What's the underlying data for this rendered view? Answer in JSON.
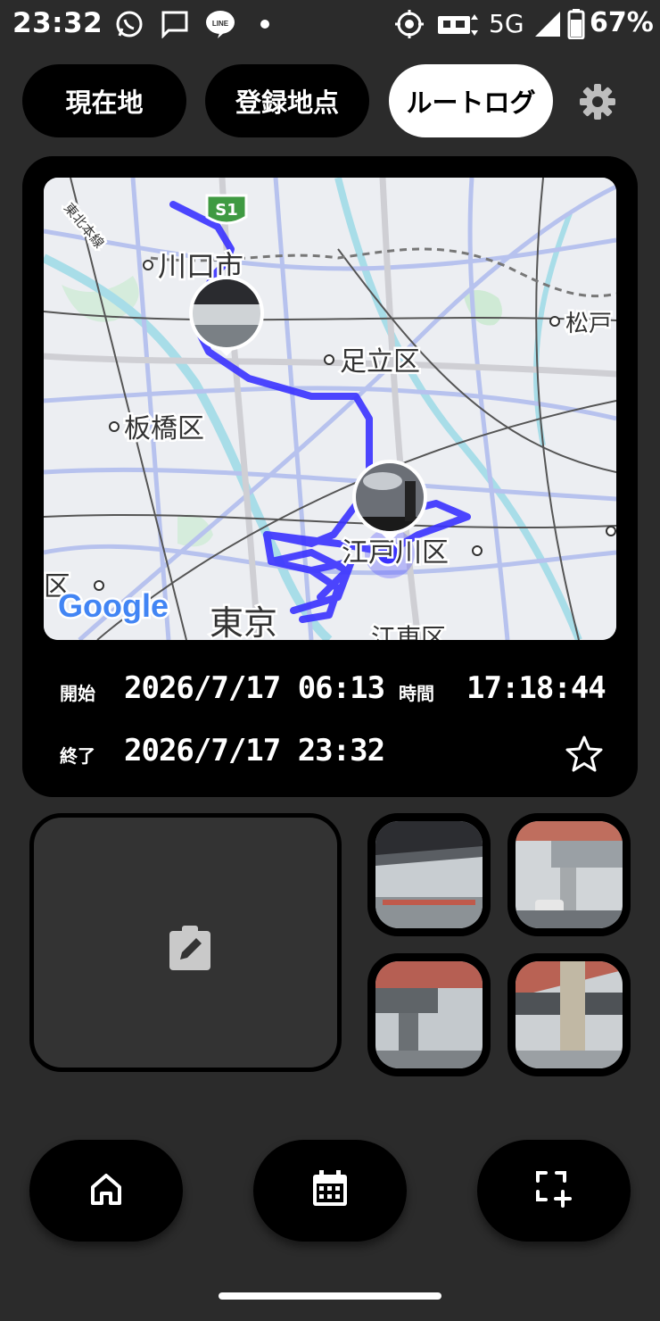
{
  "status_bar": {
    "time": "23:32",
    "network": "5G",
    "battery": "67%",
    "icons": [
      "whatsapp-icon",
      "message-icon",
      "line-icon",
      "dot-icon",
      "location-icon",
      "vibrate-icon",
      "signal-icon",
      "battery-icon"
    ]
  },
  "tabs": [
    {
      "label": "現在地",
      "active": false
    },
    {
      "label": "登録地点",
      "active": false
    },
    {
      "label": "ルートログ",
      "active": true
    }
  ],
  "map": {
    "labels": {
      "kawaguchi": "川口市",
      "adachi": "足立区",
      "itabashi": "板橋区",
      "edogawa": "江戸川区",
      "matsudo": "松戸",
      "tokyo": "東京",
      "tohoku": "東北本線",
      "koto": "江東区",
      "ku_left": "区",
      "shield": "S1"
    },
    "brand": "Google",
    "route_color": "#3a32ff"
  },
  "route_info": {
    "start_label": "開始",
    "start_value": "2026/7/17 06:13",
    "end_label": "終了",
    "end_value": "2026/7/17 23:32",
    "duration_label": "時間",
    "duration_value": "17:18:44"
  },
  "memo": {
    "icon": "clipboard-edit-icon"
  },
  "photos": [
    "photo-thumbnail-1",
    "photo-thumbnail-2",
    "photo-thumbnail-3",
    "photo-thumbnail-4"
  ],
  "bottom_nav": [
    "home-icon",
    "calendar-icon",
    "add-frame-icon"
  ],
  "colors": {
    "background": "#2b2b2b",
    "card": "#000000",
    "active_tab": "#ffffff",
    "route": "#3a32ff"
  }
}
